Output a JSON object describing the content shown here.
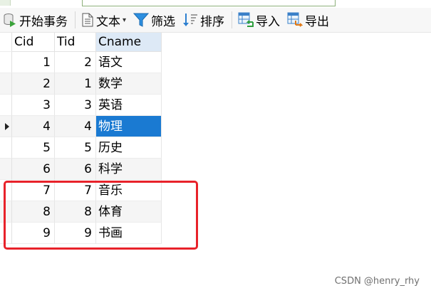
{
  "toolbar": {
    "begin_transaction": "开始事务",
    "text": "文本",
    "filter": "筛选",
    "sort": "排序",
    "import": "导入",
    "export": "导出"
  },
  "table": {
    "columns": [
      "Cid",
      "Tid",
      "Cname"
    ],
    "rows": [
      {
        "cid": "1",
        "tid": "2",
        "cname": "语文"
      },
      {
        "cid": "2",
        "tid": "1",
        "cname": "数学"
      },
      {
        "cid": "3",
        "tid": "3",
        "cname": "英语"
      },
      {
        "cid": "4",
        "tid": "4",
        "cname": "物理"
      },
      {
        "cid": "5",
        "tid": "5",
        "cname": "历史"
      },
      {
        "cid": "6",
        "tid": "6",
        "cname": "科学"
      },
      {
        "cid": "7",
        "tid": "7",
        "cname": "音乐"
      },
      {
        "cid": "8",
        "tid": "8",
        "cname": "体育"
      },
      {
        "cid": "9",
        "tid": "9",
        "cname": "书画"
      }
    ],
    "selected_row": 4,
    "highlighted_rows": [
      7,
      8,
      9
    ]
  },
  "colors": {
    "selection": "#1a7ad2",
    "highlight_box": "#e8222a"
  },
  "watermark": "CSDN @henry_rhy"
}
